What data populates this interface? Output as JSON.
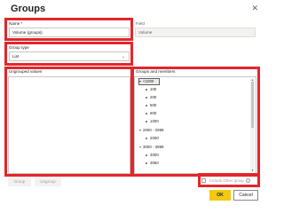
{
  "dialog": {
    "title": "Groups",
    "close_glyph": "✕"
  },
  "name_field": {
    "label": "Name *",
    "value": "Volume (groups)"
  },
  "field_info": {
    "label": "Field",
    "value": "Volume"
  },
  "group_type": {
    "label": "Group type",
    "value": "List",
    "chevron": "⌄"
  },
  "ungrouped": {
    "label": "Ungrouped values"
  },
  "groups_members": {
    "label": "Groups and members",
    "items": [
      {
        "text": "<1000",
        "kind": "group"
      },
      {
        "text": "100",
        "kind": "member"
      },
      {
        "text": "200",
        "kind": "member"
      },
      {
        "text": "500",
        "kind": "member"
      },
      {
        "text": "800",
        "kind": "member"
      },
      {
        "text": "1000",
        "kind": "member"
      },
      {
        "text": "2000 - 2999",
        "kind": "group"
      },
      {
        "text": "2000",
        "kind": "member"
      },
      {
        "text": "3000 - 3999",
        "kind": "group"
      },
      {
        "text": "3000",
        "kind": "member"
      },
      {
        "text": "3050",
        "kind": "member"
      }
    ]
  },
  "buttons": {
    "group": "Group",
    "ungroup": "Ungroup",
    "ok": "OK",
    "cancel": "Cancel"
  },
  "include_other": {
    "label": "Include Other group",
    "info": "i"
  },
  "colors": {
    "highlight": "#e3262c",
    "accent": "#f2c811"
  }
}
